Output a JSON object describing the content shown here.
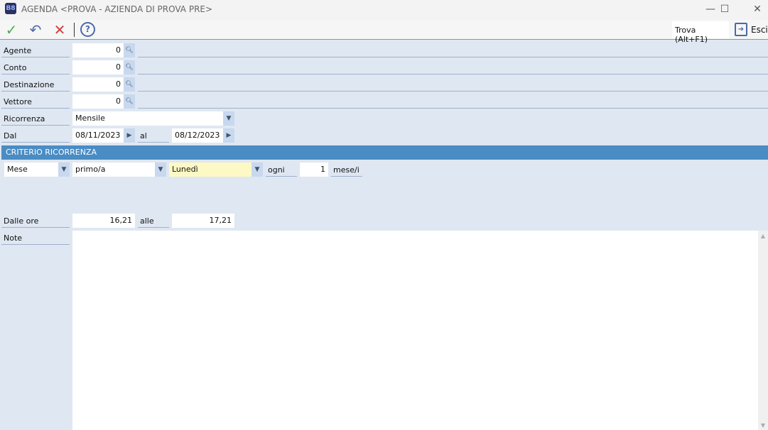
{
  "window": {
    "title": "AGENDA <PROVA - AZIENDA DI PROVA PRE>",
    "logo": "B8"
  },
  "toolbar": {
    "confirm": "✓",
    "undo": "↶",
    "cancel": "✕",
    "help": "?",
    "find": "Trova (Alt+F1)",
    "exit": "Esci"
  },
  "fields": {
    "agente": {
      "label": "Agente",
      "value": "0"
    },
    "conto": {
      "label": "Conto",
      "value": "0"
    },
    "destinazione": {
      "label": "Destinazione",
      "value": "0"
    },
    "vettore": {
      "label": "Vettore",
      "value": "0"
    },
    "ricorrenza": {
      "label": "Ricorrenza",
      "value": "Mensile"
    },
    "dal": {
      "label": "Dal",
      "value": "08/11/2023",
      "al_label": "al",
      "al_value": "08/12/2023"
    }
  },
  "criterio": {
    "title": "CRITERIO RICORRENZA",
    "unit": "Mese",
    "ordinal": "primo/a",
    "day": "Lunedì",
    "ogni_label": "ogni",
    "ogni_value": "1",
    "period_label": "mese/i"
  },
  "orari": {
    "label": "Dalle ore",
    "from": "16,21",
    "to_label": "alle",
    "to": "17,21"
  },
  "note": {
    "label": "Note",
    "value": ""
  }
}
